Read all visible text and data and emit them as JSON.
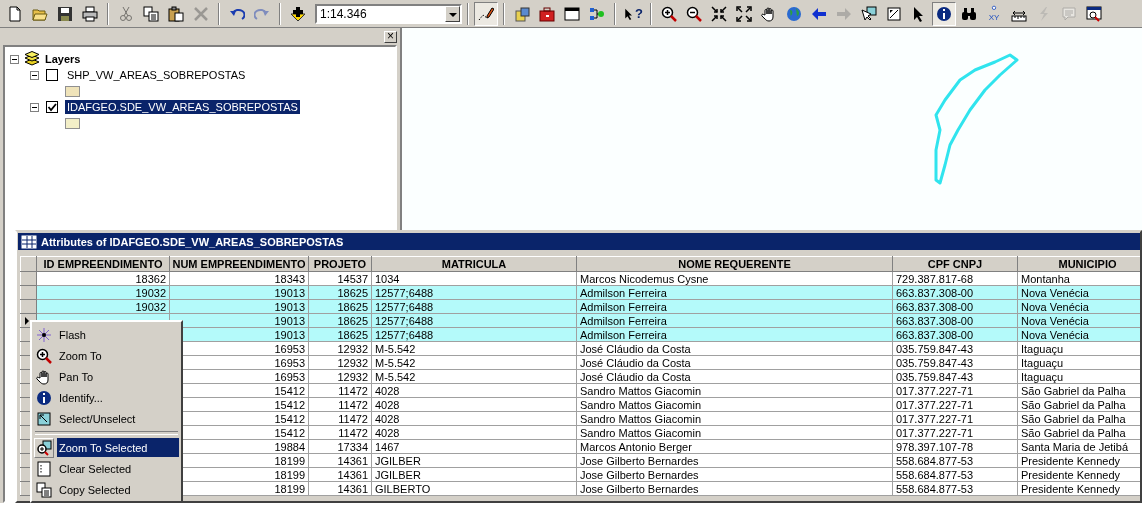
{
  "toolbar": {
    "items": [
      {
        "kind": "new",
        "disabled": false,
        "selected": false
      },
      {
        "kind": "open",
        "disabled": false,
        "selected": false
      },
      {
        "kind": "save",
        "disabled": false,
        "selected": false
      },
      {
        "kind": "print",
        "disabled": false,
        "selected": false
      },
      {
        "kind": "separator"
      },
      {
        "kind": "cut",
        "disabled": true,
        "selected": false
      },
      {
        "kind": "copy",
        "disabled": false,
        "selected": false
      },
      {
        "kind": "paste",
        "disabled": false,
        "selected": false
      },
      {
        "kind": "delete",
        "disabled": true,
        "selected": false
      },
      {
        "kind": "separator"
      },
      {
        "kind": "undo",
        "disabled": false,
        "selected": false
      },
      {
        "kind": "redo",
        "disabled": true,
        "selected": false
      },
      {
        "kind": "separator"
      },
      {
        "kind": "add",
        "disabled": false,
        "selected": false
      },
      {
        "kind": "scale",
        "value": "1:14.346"
      },
      {
        "kind": "separator"
      },
      {
        "kind": "editor",
        "disabled": false,
        "selected": true
      },
      {
        "kind": "separator"
      },
      {
        "kind": "catalog",
        "disabled": false,
        "selected": false
      },
      {
        "kind": "toolbox",
        "disabled": false,
        "selected": false
      },
      {
        "kind": "command",
        "disabled": false,
        "selected": false
      },
      {
        "kind": "model",
        "disabled": false,
        "selected": false
      },
      {
        "kind": "separator"
      },
      {
        "kind": "help",
        "label": "?",
        "disabled": false,
        "selected": false
      },
      {
        "kind": "separator"
      },
      {
        "kind": "zoomin",
        "disabled": false,
        "selected": false
      },
      {
        "kind": "zoomout",
        "disabled": false,
        "selected": false
      },
      {
        "kind": "fixedin",
        "disabled": false,
        "selected": false
      },
      {
        "kind": "fixedout",
        "disabled": false,
        "selected": false
      },
      {
        "kind": "pan",
        "disabled": false,
        "selected": false
      },
      {
        "kind": "globe",
        "disabled": false,
        "selected": false
      },
      {
        "kind": "back",
        "disabled": false,
        "selected": false
      },
      {
        "kind": "forward",
        "disabled": true,
        "selected": false
      },
      {
        "kind": "selectfeat",
        "disabled": false,
        "selected": false
      },
      {
        "kind": "clearsel",
        "disabled": false,
        "selected": false
      },
      {
        "kind": "pointer",
        "disabled": false,
        "selected": false
      },
      {
        "kind": "identify",
        "disabled": false,
        "selected": true
      },
      {
        "kind": "find",
        "disabled": false,
        "selected": false
      },
      {
        "kind": "xy",
        "label": "XY",
        "disabled": false,
        "selected": false
      },
      {
        "kind": "measure",
        "disabled": false,
        "selected": false
      },
      {
        "kind": "hyperlink",
        "disabled": true,
        "selected": false
      },
      {
        "kind": "popup",
        "disabled": true,
        "selected": false
      },
      {
        "kind": "zoomwindow",
        "disabled": false,
        "selected": false
      }
    ]
  },
  "toc": {
    "close": "×",
    "root": {
      "label": "Layers",
      "expanded": true,
      "children": [
        {
          "label": "SHP_VW_AREAS_SOBREPOSTAS",
          "expanded": true,
          "checked": false,
          "selected": false,
          "color": "#efe3b9"
        },
        {
          "label": "IDAFGEO.SDE_VW_AREAS_SOBREPOSTAS",
          "expanded": true,
          "checked": true,
          "selected": true,
          "color": "#f3efc8"
        }
      ]
    }
  },
  "attributes": {
    "title": "Attributes of IDAFGEO.SDE_VW_AREAS_SOBREPOSTAS",
    "columns": [
      {
        "label": "ID EMPREENDIMENTO",
        "numeric": true
      },
      {
        "label": "NUM EMPREENDIMENTO",
        "numeric": true
      },
      {
        "label": "PROJETO",
        "numeric": true
      },
      {
        "label": "MATRICULA",
        "numeric": false
      },
      {
        "label": "NOME REQUERENTE",
        "numeric": false
      },
      {
        "label": "CPF CNPJ",
        "numeric": false
      },
      {
        "label": "MUNICIPIO",
        "numeric": false
      }
    ],
    "rows": [
      {
        "selected": false,
        "current": false,
        "cells": [
          "18362",
          "18343",
          "14537",
          "1034",
          "Marcos Nicodemus Cysne",
          "729.387.817-68",
          "Montanha"
        ]
      },
      {
        "selected": true,
        "current": false,
        "cells": [
          "19032",
          "19013",
          "18625",
          "12577;6488",
          "Admilson Ferreira",
          "663.837.308-00",
          "Nova Venécia"
        ]
      },
      {
        "selected": true,
        "current": false,
        "cells": [
          "19032",
          "19013",
          "18625",
          "12577;6488",
          "Admilson Ferreira",
          "663.837.308-00",
          "Nova Venécia"
        ]
      },
      {
        "selected": true,
        "current": true,
        "cells": [
          null,
          "19013",
          "18625",
          "12577;6488",
          "Admilson Ferreira",
          "663.837.308-00",
          "Nova Venécia"
        ]
      },
      {
        "selected": true,
        "current": false,
        "cells": [
          null,
          "19013",
          "18625",
          "12577;6488",
          "Admilson Ferreira",
          "663.837.308-00",
          "Nova Venécia"
        ]
      },
      {
        "selected": false,
        "current": false,
        "cells": [
          null,
          "16953",
          "12932",
          "M-5.542",
          "José Cláudio da Costa",
          "035.759.847-43",
          "Itaguaçu"
        ]
      },
      {
        "selected": false,
        "current": false,
        "cells": [
          null,
          "16953",
          "12932",
          "M-5.542",
          "José Cláudio da Costa",
          "035.759.847-43",
          "Itaguaçu"
        ]
      },
      {
        "selected": false,
        "current": false,
        "cells": [
          null,
          "16953",
          "12932",
          "M-5.542",
          "José Cláudio da Costa",
          "035.759.847-43",
          "Itaguaçu"
        ]
      },
      {
        "selected": false,
        "current": false,
        "cells": [
          null,
          "15412",
          "11472",
          "4028",
          "Sandro Mattos Giacomin",
          "017.377.227-71",
          "São Gabriel da Palha"
        ]
      },
      {
        "selected": false,
        "current": false,
        "cells": [
          null,
          "15412",
          "11472",
          "4028",
          "Sandro Mattos Giacomin",
          "017.377.227-71",
          "São Gabriel da Palha"
        ]
      },
      {
        "selected": false,
        "current": false,
        "cells": [
          null,
          "15412",
          "11472",
          "4028",
          "Sandro Mattos Giacomin",
          "017.377.227-71",
          "São Gabriel da Palha"
        ]
      },
      {
        "selected": false,
        "current": false,
        "cells": [
          null,
          "15412",
          "11472",
          "4028",
          "Sandro Mattos Giacomin",
          "017.377.227-71",
          "São Gabriel da Palha"
        ]
      },
      {
        "selected": false,
        "current": false,
        "cells": [
          null,
          "19884",
          "17334",
          "1467",
          "Marcos Antonio Berger",
          "978.397.107-78",
          "Santa Maria de Jetibá"
        ]
      },
      {
        "selected": false,
        "current": false,
        "cells": [
          null,
          "18199",
          "14361",
          "JGILBER",
          "Jose Gilberto Bernardes",
          "558.684.877-53",
          "Presidente Kennedy"
        ]
      },
      {
        "selected": false,
        "current": false,
        "cells": [
          null,
          "18199",
          "14361",
          "JGILBER",
          "Jose Gilberto Bernardes",
          "558.684.877-53",
          "Presidente Kennedy"
        ]
      },
      {
        "selected": false,
        "current": false,
        "cells": [
          null,
          "18199",
          "14361",
          "GILBERTO",
          "Jose Gilberto Bernardes",
          "558.684.877-53",
          "Presidente Kennedy"
        ]
      }
    ]
  },
  "context_menu": {
    "items": [
      {
        "kind": "flash",
        "label": "Flash",
        "selected": false
      },
      {
        "kind": "zoomin",
        "label": "Zoom To",
        "selected": false
      },
      {
        "kind": "pan",
        "label": "Pan To",
        "selected": false
      },
      {
        "kind": "identify",
        "label": "Identify...",
        "selected": false
      },
      {
        "kind": "selectbox",
        "label": "Select/Unselect",
        "selected": false
      },
      {
        "kind": "separator"
      },
      {
        "kind": "zoomsel",
        "label": "Zoom To Selected",
        "selected": true
      },
      {
        "kind": "clearbox",
        "label": "Clear Selected",
        "selected": false
      },
      {
        "kind": "copy",
        "label": "Copy Selected",
        "selected": false
      }
    ]
  }
}
